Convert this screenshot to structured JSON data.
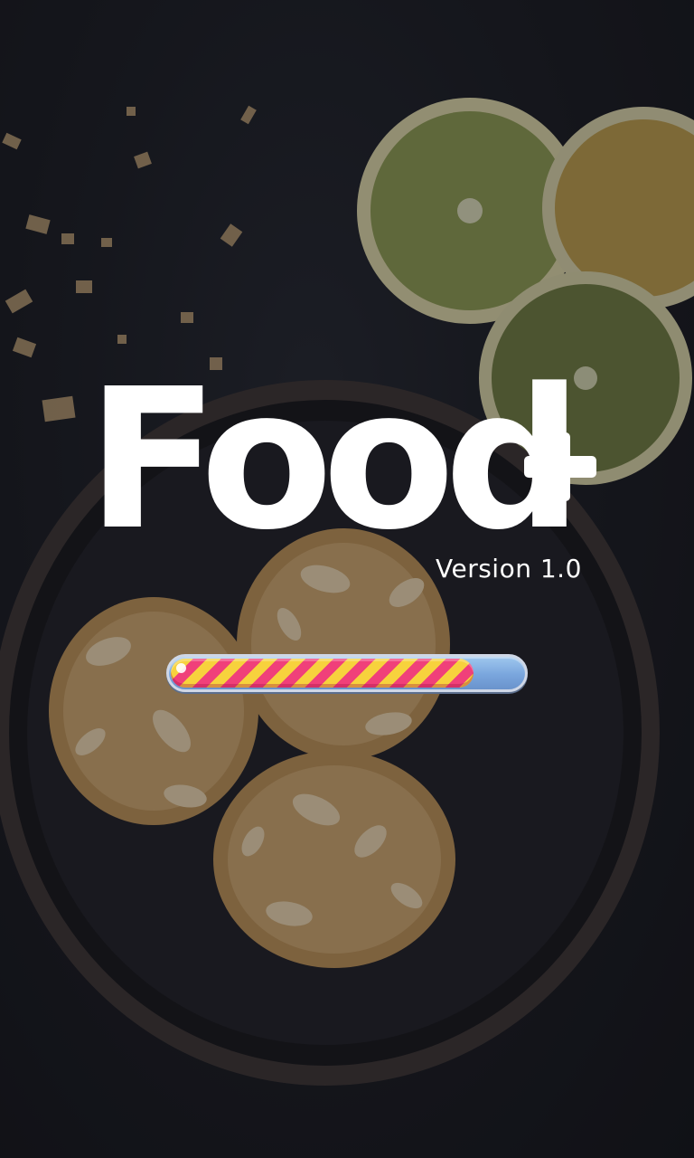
{
  "app": {
    "brand_name": "Food",
    "brand_suffix": "+",
    "version_text": "Version 1.0"
  },
  "loading": {
    "progress": 0.86
  },
  "background": {
    "scene": "cookies-in-bowl-with-lemon-slices"
  },
  "colors": {
    "logo": "#ffffff",
    "progress_stripe_a": "#f7d23d",
    "progress_stripe_b": "#f0407a",
    "progress_track": "#7aa6dd"
  }
}
